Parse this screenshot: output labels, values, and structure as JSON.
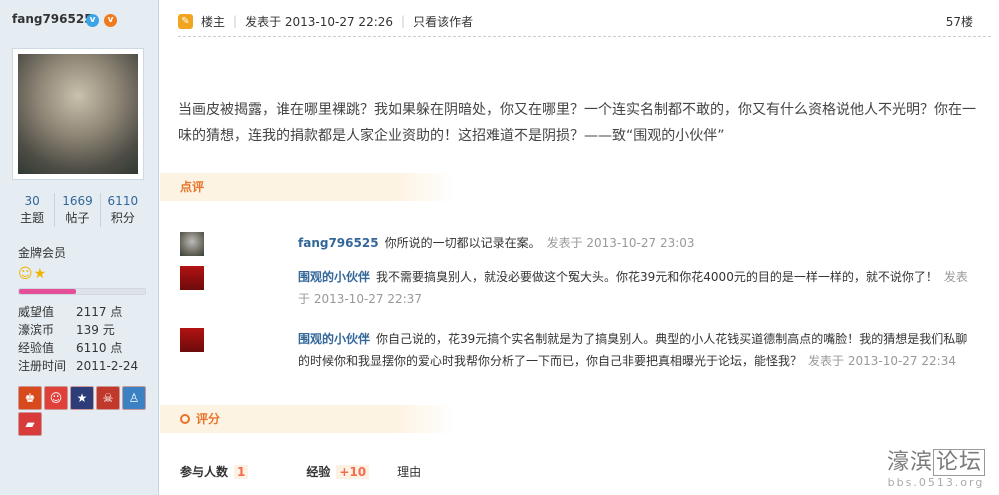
{
  "user": {
    "name": "fang796525",
    "badge_v": "v",
    "badge_vip": "v",
    "stats": [
      {
        "num": "30",
        "label": "主题"
      },
      {
        "num": "1669",
        "label": "帖子"
      },
      {
        "num": "6110",
        "label": "积分"
      }
    ],
    "rank": "金牌会员",
    "stars": "☺★",
    "progress": 0.45,
    "info": [
      {
        "k": "威望值",
        "v": "2117 点"
      },
      {
        "k": "濠滨币",
        "v": "139 元"
      },
      {
        "k": "经验值",
        "v": "6110 点"
      },
      {
        "k": "注册时间",
        "v": "2011-2-24"
      }
    ],
    "medals": [
      {
        "icon": "medal-1-icon",
        "color": "#d84a1b",
        "glyph": "♚"
      },
      {
        "icon": "medal-2-icon",
        "color": "#e0403a",
        "glyph": "☺"
      },
      {
        "icon": "medal-3-icon",
        "color": "#2d3d7a",
        "glyph": "★"
      },
      {
        "icon": "medal-4-icon",
        "color": "#c0392b",
        "glyph": "☠"
      },
      {
        "icon": "medal-5-icon",
        "color": "#3b82c4",
        "glyph": "♙"
      },
      {
        "icon": "medal-6-icon",
        "color": "#d93a3a",
        "glyph": "▰"
      }
    ]
  },
  "post": {
    "author_tag": "楼主",
    "posted": "发表于 2013-10-27 22:26",
    "only_author": "只看该作者",
    "floor": "57楼",
    "content": "当画皮被揭露，谁在哪里裸跳？我如果躲在阴暗处，你又在哪里？一个连实名制都不敢的，你又有什么资格说他人不光明？你在一味的猜想，连我的捐款都是人家企业资助的！这招难道不是阴损？——致“围观的小伙伴”"
  },
  "dianping": {
    "title": "点评",
    "comments": [
      {
        "who": "fang796525",
        "text": "你所说的一切都以记录在案。",
        "when": "发表于 2013-10-27 23:03"
      },
      {
        "who": "围观的小伙伴",
        "text": "我不需要搞臭别人，就没必要做这个冤大头。你花39元和你花4000元的目的是一样一样的，就不说你了！",
        "when": "发表于 2013-10-27 22:37"
      },
      {
        "who": "围观的小伙伴",
        "text": "你自己说的，花39元搞个实名制就是为了搞臭别人。典型的小人花钱买道德制高点的嘴脸！我的猜想是我们私聊的时候你和我显摆你的爱心时我帮你分析了一下而已，你自己非要把真相曝光于论坛，能怪我？",
        "when": "发表于 2013-10-27 22:34"
      }
    ]
  },
  "pingfen": {
    "title": "评分",
    "participants_label": "参与人数",
    "participants": "1",
    "exp_label": "经验",
    "exp_value": "+10",
    "reason_label": "理由"
  },
  "watermark": {
    "big": "濠滨",
    "box": "论坛",
    "small": "bbs.0513.org"
  }
}
